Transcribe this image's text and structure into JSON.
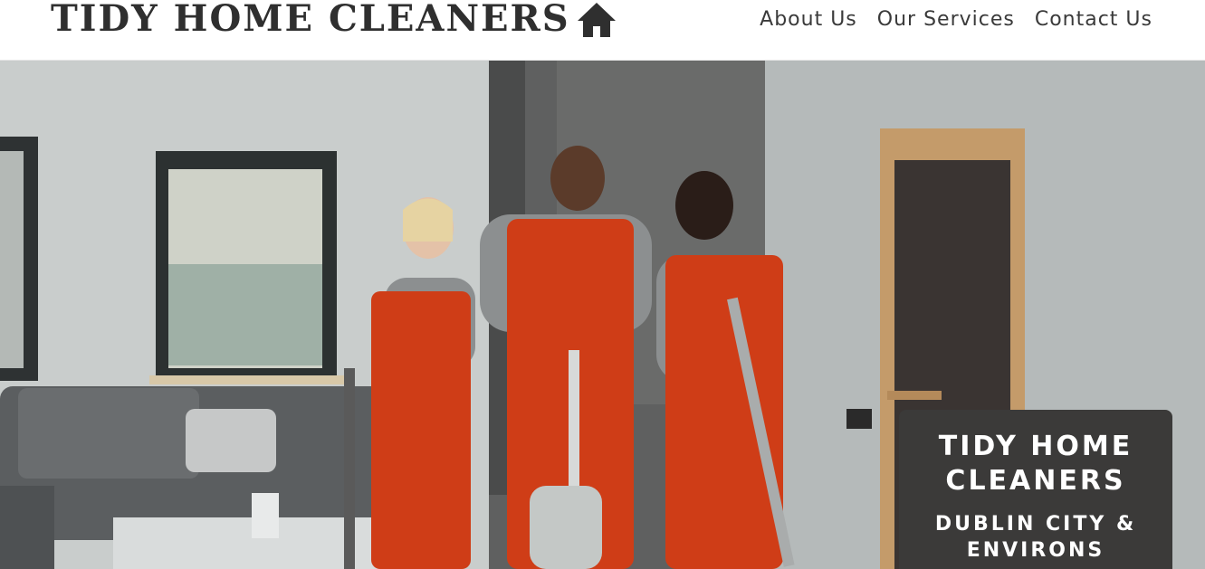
{
  "header": {
    "brand": "TIDY HOME CLEANERS",
    "brand_icon": "house-icon",
    "nav": [
      {
        "label": "About Us"
      },
      {
        "label": "Our Services"
      },
      {
        "label": "Contact Us"
      }
    ]
  },
  "hero": {
    "banner_title": "TIDY HOME CLEANERS",
    "banner_subtitle": "DUBLIN CITY & ENVIRONS"
  },
  "colors": {
    "text_dark": "#2f2f2f",
    "banner_bg": "#3b3a39",
    "uniform_orange": "#cf3d17",
    "wall_grey": "#c8cccc"
  }
}
